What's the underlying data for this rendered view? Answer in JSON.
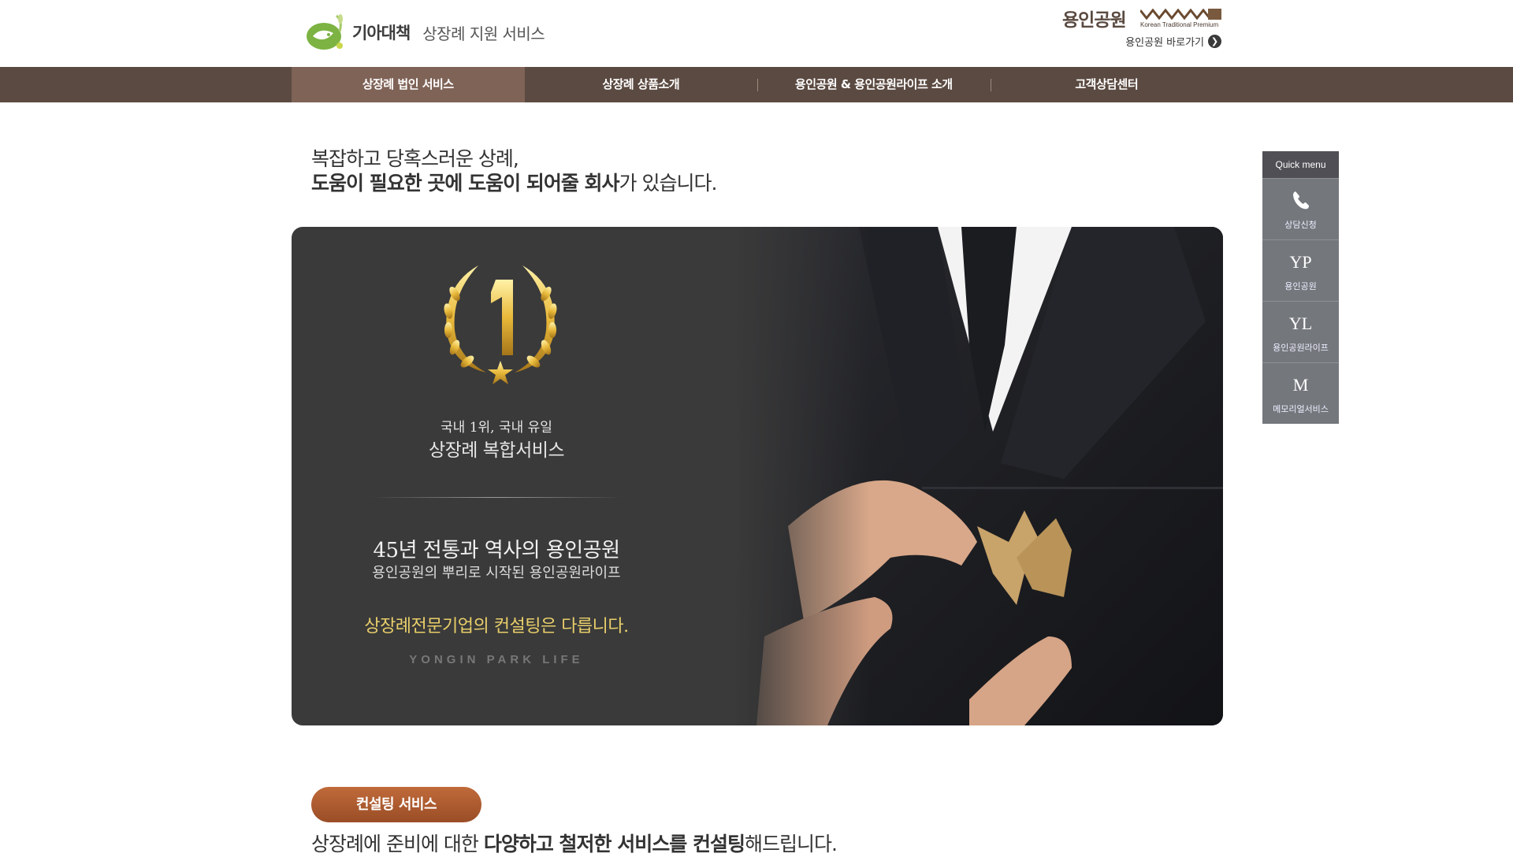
{
  "header": {
    "brand": "기아대책",
    "service_name": "상장례 지원 서비스",
    "park_name": "용인공원",
    "park_tagline": "Korean Traditional Premium",
    "park_link": "용인공원 바로가기"
  },
  "nav": {
    "items": [
      {
        "label": "상장례 법인 서비스"
      },
      {
        "label": "상장례 상품소개"
      },
      {
        "label": "용인공원 & 용인공원라이프 소개"
      },
      {
        "label": "고객상담센터"
      }
    ]
  },
  "quick_menu": {
    "title": "Quick menu",
    "items": [
      {
        "label": "상담신청",
        "icon": "phone-icon"
      },
      {
        "label": "용인공원",
        "letter": "YP"
      },
      {
        "label": "용인공원라이프",
        "letter": "YL"
      },
      {
        "label": "메모리얼서비스",
        "letter": "M"
      }
    ]
  },
  "headline": {
    "line1": "복잡하고 당혹스러운 상례,",
    "line2_bold": "도움이 필요한 곳에 도움이 되어줄 회사",
    "line2_rest": "가 있습니다."
  },
  "banner": {
    "award_number": "1",
    "small": "국내 1위, 국내 유일",
    "medium": "상장례 복합서비스",
    "title": "45년 전통과 역사의 용인공원",
    "subtitle": "용인공원의 뿌리로 시작된 용인공원라이프",
    "gold_text": "상장례전문기업의 컨설팅은 다릅니다.",
    "english": "YONGIN PARK LIFE"
  },
  "consulting": {
    "pill_label": "컨설팅 서비스",
    "line_prefix": "상장례에 준비에 대한 ",
    "line_bold": "다양하고 철저한 서비스를 컨설팅",
    "line_suffix": "해드립니다."
  },
  "colors": {
    "nav_bg": "#5b4a41",
    "nav_active": "#7f6357",
    "quick_head": "#4f4f55",
    "quick_item": "#74777c",
    "pill": "#b05e32",
    "gold": "#e9cf6a"
  }
}
